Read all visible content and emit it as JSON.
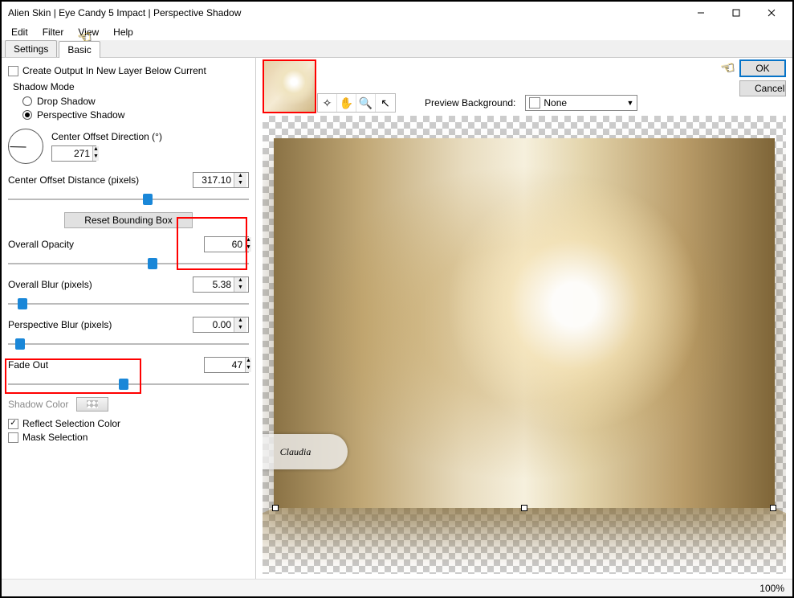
{
  "window": {
    "title": "Alien Skin | Eye Candy 5 Impact | Perspective Shadow"
  },
  "menu": {
    "edit": "Edit",
    "filter": "Filter",
    "view": "View",
    "help": "Help"
  },
  "tabs": {
    "settings": "Settings",
    "basic": "Basic"
  },
  "left": {
    "create_output": "Create Output In New Layer Below Current",
    "shadow_mode": "Shadow Mode",
    "drop_shadow": "Drop Shadow",
    "perspective_shadow": "Perspective Shadow",
    "center_offset_dir": "Center Offset Direction (°)",
    "center_offset_dir_val": "271",
    "center_offset_dist": "Center Offset Distance (pixels)",
    "center_offset_dist_val": "317.10",
    "reset_btn": "Reset Bounding Box",
    "overall_opacity": "Overall Opacity",
    "overall_opacity_val": "60",
    "overall_blur": "Overall Blur (pixels)",
    "overall_blur_val": "5.38",
    "perspective_blur": "Perspective Blur (pixels)",
    "perspective_blur_val": "0.00",
    "fade_out": "Fade Out",
    "fade_out_val": "47",
    "shadow_color": "Shadow Color",
    "reflect_sel": "Reflect Selection Color",
    "mask_sel": "Mask Selection"
  },
  "right": {
    "ok": "OK",
    "cancel": "Cancel",
    "preview_bg": "Preview Background:",
    "preview_bg_val": "None"
  },
  "status": {
    "zoom": "100%"
  },
  "watermark": "Claudia"
}
